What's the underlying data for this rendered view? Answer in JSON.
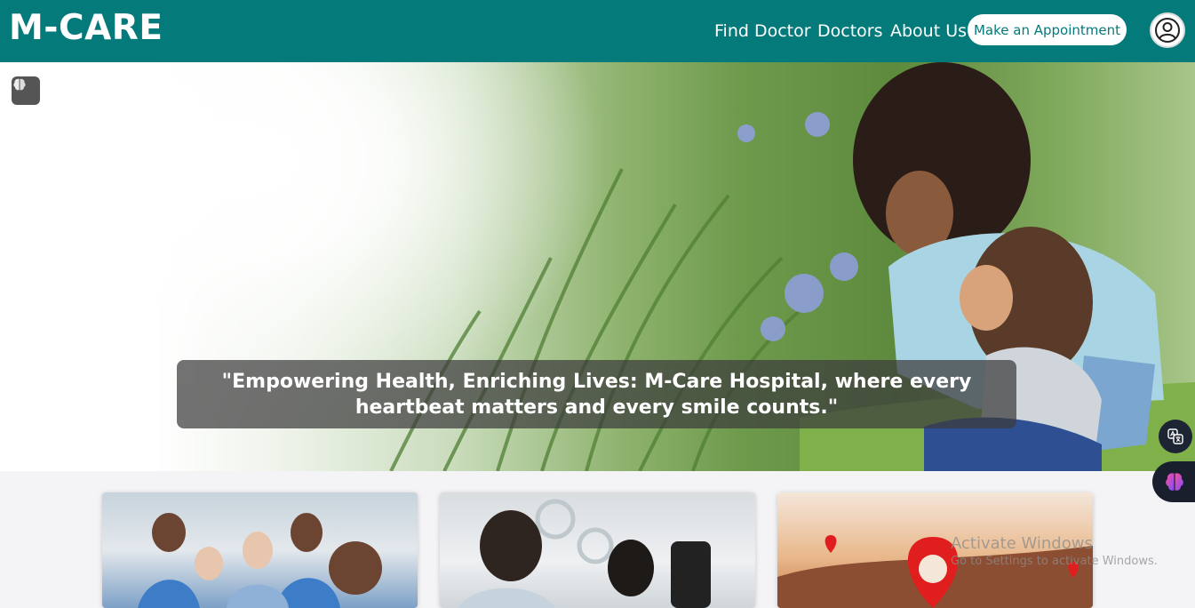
{
  "header": {
    "brand": "M-CARE",
    "nav": [
      {
        "label": "Find Doctor"
      },
      {
        "label": "Doctors"
      },
      {
        "label": "About Us"
      }
    ],
    "cta_label": "Make an Appointment",
    "avatar_icon": "user-circle-icon"
  },
  "hero": {
    "quote": "\"Empowering Health, Enriching Lives: M-Care Hospital, where every heartbeat matters and every smile counts.\"",
    "tool_icon": "brain-icon"
  },
  "floating": {
    "translate_icon": "translate-icon",
    "assistant_icon": "brain-icon"
  },
  "cards": [
    {
      "image": "medical-team-photo"
    },
    {
      "image": "doctor-consultation-photo"
    },
    {
      "image": "location-pin-photo"
    }
  ],
  "watermark": {
    "title": "Activate Windows",
    "subtitle": "Go to Settings to activate Windows."
  },
  "colors": {
    "primary": "#047a7a",
    "header_text": "#ffffff",
    "overlay": "#3c3c3c"
  }
}
